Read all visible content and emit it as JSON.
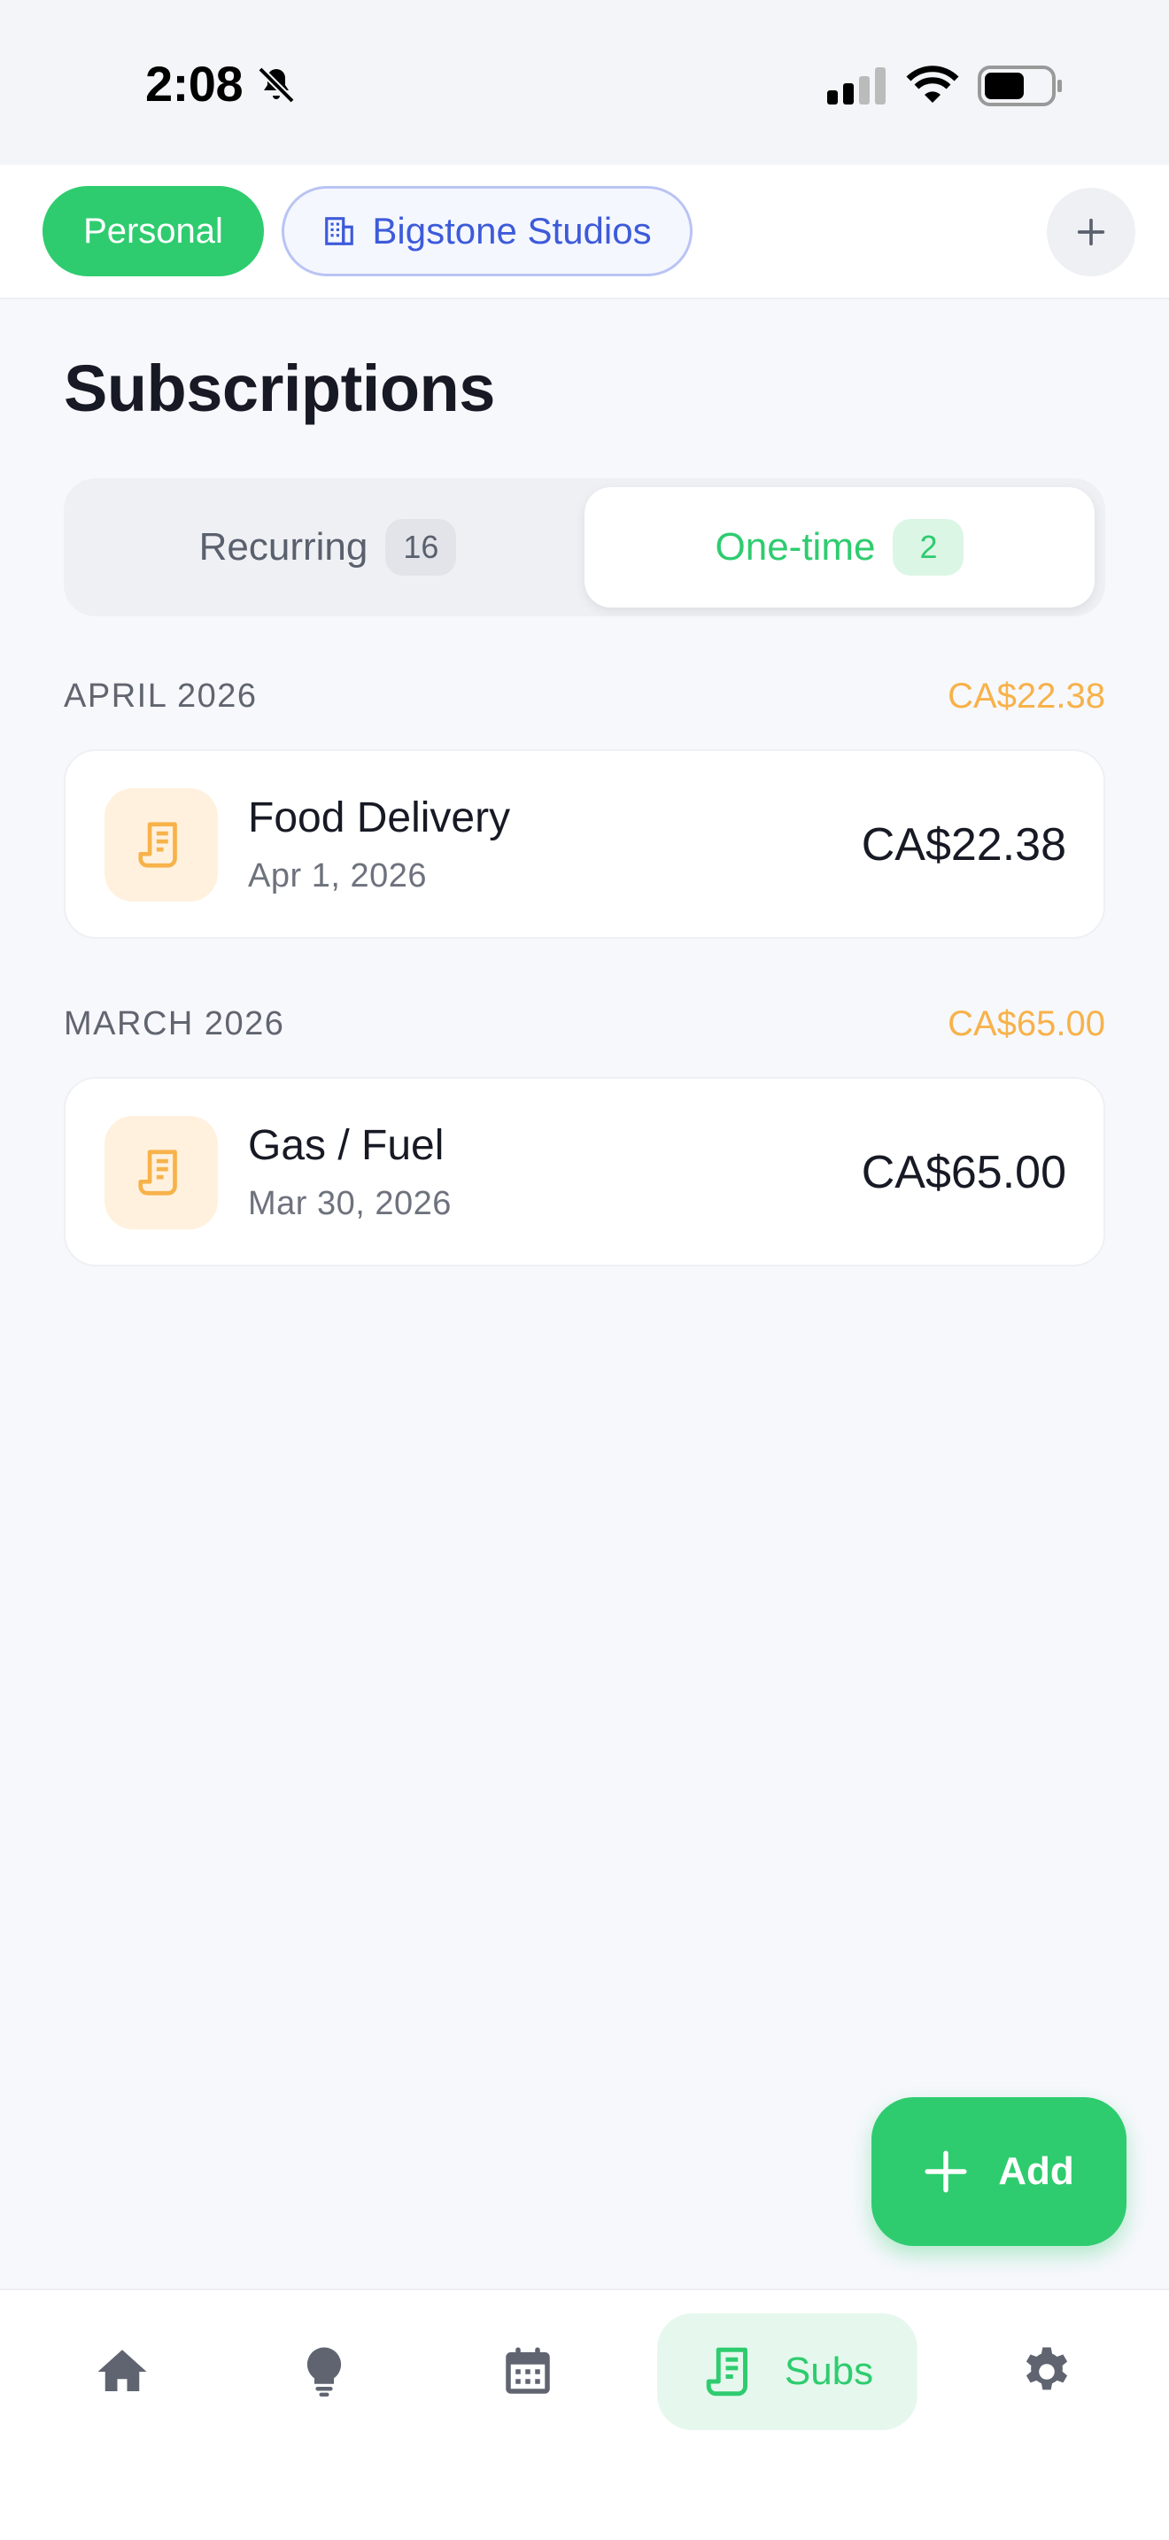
{
  "status_bar": {
    "time": "2:08"
  },
  "workspaces": {
    "personal_label": "Personal",
    "company_label": "Bigstone Studios"
  },
  "page": {
    "title": "Subscriptions"
  },
  "tabs": {
    "recurring": {
      "label": "Recurring",
      "count": "16"
    },
    "one_time": {
      "label": "One-time",
      "count": "2"
    }
  },
  "sections": [
    {
      "month": "APRIL 2026",
      "total": "CA$22.38",
      "items": [
        {
          "name": "Food Delivery",
          "date": "Apr 1, 2026",
          "amount": "CA$22.38",
          "icon": "receipt-icon"
        }
      ]
    },
    {
      "month": "MARCH 2026",
      "total": "CA$65.00",
      "items": [
        {
          "name": "Gas / Fuel",
          "date": "Mar 30, 2026",
          "amount": "CA$65.00",
          "icon": "receipt-icon"
        }
      ]
    }
  ],
  "fab": {
    "label": "Add"
  },
  "nav": {
    "items": [
      {
        "icon": "home-icon"
      },
      {
        "icon": "lightbulb-icon"
      },
      {
        "icon": "calendar-icon"
      },
      {
        "icon": "receipt-icon",
        "label": "Subs",
        "active": true
      },
      {
        "icon": "gear-icon"
      }
    ]
  },
  "colors": {
    "accent": "#2ecc6f",
    "company_accent": "#3d5bd9",
    "amount_highlight": "#f7b24a",
    "icon_bg": "#fff1de"
  }
}
